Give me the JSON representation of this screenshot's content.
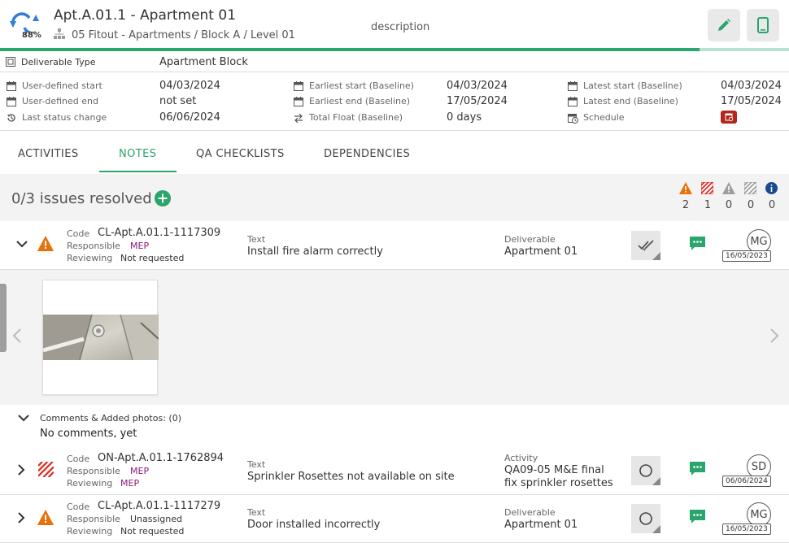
{
  "header": {
    "title": "Apt.A.01.1 - Apartment 01",
    "breadcrumb": "05 Fitout - Apartments / Block A / Level 01",
    "description": "description",
    "progress_label": "88%",
    "progress_value": 0.887,
    "edit_icon": "pencil-icon",
    "mobile_icon": "phone-icon",
    "accent": "#2aa56b"
  },
  "info": {
    "deliverable_type_label": "Deliverable Type",
    "deliverable_type_value": "Apartment Block",
    "col1": [
      {
        "label": "User-defined start",
        "value": "04/03/2024",
        "icon": "calendar-icon"
      },
      {
        "label": "User-defined end",
        "value": "not set",
        "icon": "calendar-icon"
      },
      {
        "label": "Last status change",
        "value": "06/06/2024",
        "icon": "history-icon"
      }
    ],
    "col2": [
      {
        "label": "Earliest start (Baseline)",
        "value": "04/03/2024",
        "icon": "calendar-icon"
      },
      {
        "label": "Earliest end (Baseline)",
        "value": "17/05/2024",
        "icon": "calendar-icon"
      },
      {
        "label": "Total Float (Baseline)",
        "value": "0 days",
        "icon": "swap-icon"
      }
    ],
    "col3": [
      {
        "label": "Latest start (Baseline)",
        "value": "04/03/2024",
        "icon": "calendar-icon"
      },
      {
        "label": "Latest end (Baseline)",
        "value": "17/05/2024",
        "icon": "calendar-icon"
      },
      {
        "label": "Schedule",
        "value": "",
        "icon": "calendar-clock-icon"
      }
    ]
  },
  "tabs": [
    {
      "label": "ACTIVITIES"
    },
    {
      "label": "NOTES"
    },
    {
      "label": "QA CHECKLISTS"
    },
    {
      "label": "DEPENDENCIES"
    }
  ],
  "issues": {
    "resolved_text": "0/3 issues resolved",
    "counts": [
      "2",
      "1",
      "0",
      "0",
      "0"
    ],
    "colors": {
      "warning": "#e8710a",
      "stripe": "#d93025",
      "grey": "#9e9e9e",
      "info": "#1a4a8f",
      "comment": "#2aa56b"
    }
  },
  "rows": [
    {
      "code_label": "Code",
      "code": "CL-Apt.A.01.1-1117309",
      "responsible_label": "Responsible",
      "responsible": "MEP",
      "reviewing_label": "Reviewing",
      "reviewing": "Not requested",
      "text_label": "Text",
      "text": "Install fire alarm correctly",
      "ref_label": "Deliverable",
      "ref": "Apartment 01",
      "avatar": "MG",
      "date": "16/05/2023"
    },
    {
      "code_label": "Code",
      "code": "ON-Apt.A.01.1-1762894",
      "responsible_label": "Responsible",
      "responsible": "MEP",
      "reviewing_label": "Reviewing",
      "reviewing": "MEP",
      "text_label": "Text",
      "text": "Sprinkler Rosettes not available on site",
      "ref_label": "Activity",
      "ref_line1": "QA09-05 M&E final",
      "ref_line2": "fix sprinkler rosettes",
      "avatar": "SD",
      "date": "06/06/2024"
    },
    {
      "code_label": "Code",
      "code": "CL-Apt.A.01.1-1117279",
      "responsible_label": "Responsible",
      "responsible": "Unassigned",
      "reviewing_label": "Reviewing",
      "reviewing": "Not requested",
      "text_label": "Text",
      "text": "Door installed incorrectly",
      "ref_label": "Deliverable",
      "ref": "Apartment 01",
      "avatar": "MG",
      "date": "16/05/2023"
    }
  ],
  "comments": {
    "header": "Comments & Added photos: (0)",
    "empty": "No comments, yet"
  }
}
